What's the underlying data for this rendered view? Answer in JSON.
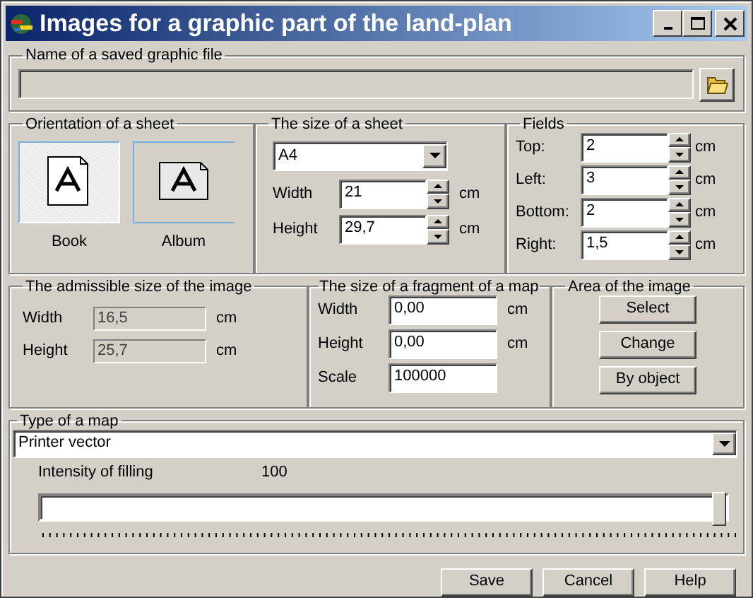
{
  "window": {
    "title": "Images for a graphic part of the land-plan"
  },
  "file_group": {
    "legend": "Name of a saved graphic file"
  },
  "orientation": {
    "legend": "Orientation of a sheet",
    "options": [
      {
        "label": "Book",
        "selected": true
      },
      {
        "label": "Album",
        "selected": false
      }
    ]
  },
  "sheet_size": {
    "legend": "The size of a sheet",
    "paper": "A4",
    "rows": [
      {
        "label": "Width",
        "value": "21",
        "unit": "cm"
      },
      {
        "label": "Height",
        "value": "29,7",
        "unit": "cm"
      }
    ]
  },
  "fields": {
    "legend": "Fields",
    "rows": [
      {
        "label": "Top:",
        "value": "2",
        "unit": "cm"
      },
      {
        "label": "Left:",
        "value": "3",
        "unit": "cm"
      },
      {
        "label": "Bottom:",
        "value": "2",
        "unit": "cm"
      },
      {
        "label": "Right:",
        "value": "1,5",
        "unit": "cm"
      }
    ]
  },
  "admissible": {
    "legend": "The admissible size of the image",
    "rows": [
      {
        "label": "Width",
        "value": "16,5",
        "unit": "cm",
        "disabled": true
      },
      {
        "label": "Height",
        "value": "25,7",
        "unit": "cm",
        "disabled": true
      }
    ]
  },
  "fragment": {
    "legend": "The size of a fragment of a map",
    "rows": [
      {
        "label": "Width",
        "value": "0,00",
        "unit": "cm"
      },
      {
        "label": "Height",
        "value": "0,00",
        "unit": "cm"
      },
      {
        "label": "Scale",
        "value": "100000"
      }
    ]
  },
  "area": {
    "legend": "Area of the image",
    "buttons": [
      "Select",
      "Change",
      "By object"
    ]
  },
  "map_type": {
    "legend": "Type of a map",
    "type": "Printer vector",
    "intensity_label": "Intensity of filling",
    "intensity_reading": "100",
    "level": 1
  },
  "buttons": [
    "Save",
    "Cancel",
    "Help"
  ]
}
